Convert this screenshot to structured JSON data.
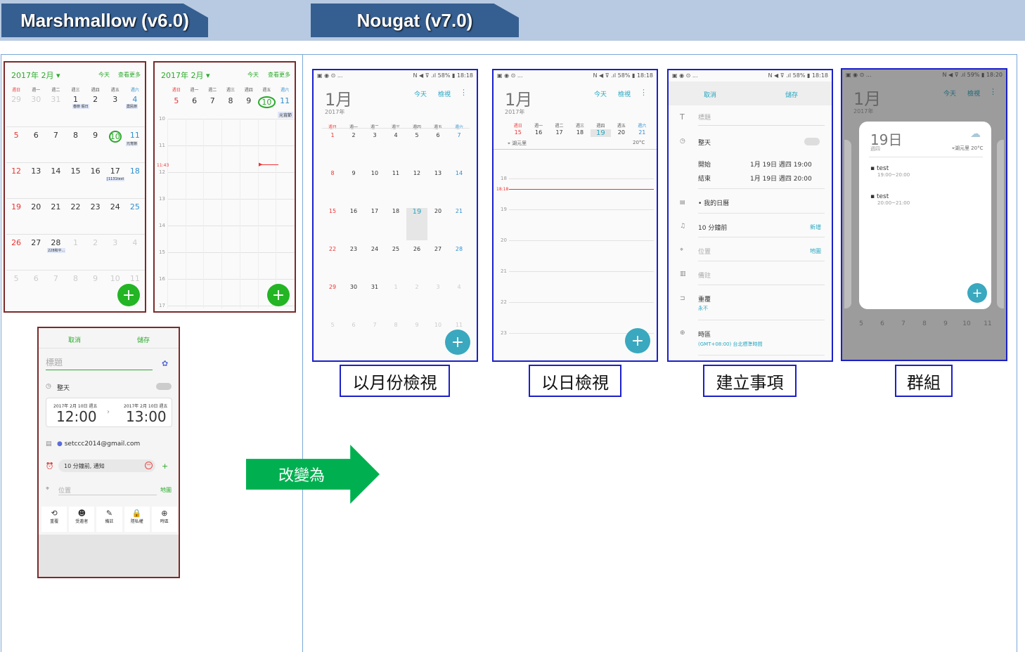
{
  "header": {
    "tab_left": "Marshmallow (v6.0)",
    "tab_right": "Nougat (v7.0)"
  },
  "arrow_label": "改變為",
  "captions": [
    "以月份檢視",
    "以日檢視",
    "建立事項",
    "群組"
  ],
  "m_month": {
    "title": "2017年 2月",
    "today": "今天",
    "more": "查看更多",
    "weekdays": [
      "週日",
      "週一",
      "週二",
      "週三",
      "週四",
      "週五",
      "週六"
    ],
    "weeks": [
      [
        "29",
        "30",
        "31",
        "1",
        "2",
        "3",
        "4"
      ],
      [
        "5",
        "6",
        "7",
        "8",
        "9",
        "10",
        "11"
      ],
      [
        "12",
        "13",
        "14",
        "15",
        "16",
        "17",
        "18"
      ],
      [
        "19",
        "20",
        "21",
        "22",
        "23",
        "24",
        "25"
      ],
      [
        "26",
        "27",
        "28",
        "1",
        "2",
        "3",
        "4"
      ],
      [
        "5",
        "6",
        "7",
        "8",
        "9",
        "10",
        "11"
      ]
    ],
    "events": [
      "春節 假日",
      "農民節",
      "元宵節",
      "[1131test",
      "228和平..."
    ],
    "fab": "+"
  },
  "m_day": {
    "title": "2017年 2月",
    "today": "今天",
    "more": "查看更多",
    "weekdays": [
      "週日",
      "週一",
      "週二",
      "週三",
      "週四",
      "週五",
      "週六"
    ],
    "days": [
      "5",
      "6",
      "7",
      "8",
      "9",
      "10",
      "11"
    ],
    "event": "元宵節",
    "hours": [
      "10",
      "11",
      "12",
      "13",
      "14",
      "15",
      "16",
      "17"
    ],
    "now": "11:43",
    "fab": "+"
  },
  "m_create": {
    "cancel": "取消",
    "save": "儲存",
    "title_placeholder": "標題",
    "allday": "整天",
    "start_date": "2017年 2月 10日 週五",
    "start_time": "12:00",
    "end_date": "2017年 2月 10日 週五",
    "end_time": "13:00",
    "account": "setccc2014@gmail.com",
    "reminder": "10 分鐘前, 通知",
    "location": "位置",
    "map": "地圖",
    "tools": [
      "重覆",
      "受邀者",
      "備註",
      "隱私權",
      "時區"
    ]
  },
  "n_month": {
    "status_left": "▣ ◉ ⊙ ...",
    "status_right": "N ◀ ⊽ .ıl 58% ▮ 18:18",
    "title": "1月",
    "year": "2017年",
    "today": "今天",
    "view": "檢視",
    "weekdays": [
      "週日",
      "週一",
      "週二",
      "週三",
      "週四",
      "週五",
      "週六"
    ],
    "weeks": [
      [
        "1",
        "2",
        "3",
        "4",
        "5",
        "6",
        "7"
      ],
      [
        "8",
        "9",
        "10",
        "11",
        "12",
        "13",
        "14"
      ],
      [
        "15",
        "16",
        "17",
        "18",
        "19",
        "20",
        "21"
      ],
      [
        "22",
        "23",
        "24",
        "25",
        "26",
        "27",
        "28"
      ],
      [
        "29",
        "30",
        "31",
        "1",
        "2",
        "3",
        "4"
      ],
      [
        "5",
        "6",
        "7",
        "8",
        "9",
        "10",
        "11"
      ]
    ],
    "fab": "+"
  },
  "n_day": {
    "status_left": "▣ ◉ ⊙ ...",
    "status_right": "N ◀ ⊽ .ıl 58% ▮ 18:18",
    "title": "1月",
    "year": "2017年",
    "today": "今天",
    "view": "檢視",
    "weekdays": [
      "週日",
      "週一",
      "週二",
      "週三",
      "週四",
      "週五",
      "週六"
    ],
    "days": [
      "15",
      "16",
      "17",
      "18",
      "19",
      "20",
      "21"
    ],
    "location": "湖元里",
    "temp": "20°C",
    "hours": [
      "18",
      "19",
      "20",
      "21",
      "22",
      "23"
    ],
    "now": "18:18",
    "fab": "+"
  },
  "n_create": {
    "status_left": "▣ ◉ ⊙ ...",
    "status_right": "N ◀ ⊽ .ıl 58% ▮ 18:18",
    "cancel": "取消",
    "save": "儲存",
    "title_placeholder": "標題",
    "allday": "整天",
    "start_label": "開始",
    "start_value": "1月 19日 週四 19:00",
    "end_label": "結束",
    "end_value": "1月 19日 週四 20:00",
    "calendar": "• 我的日曆",
    "reminder": "10 分鐘前",
    "add": "新增",
    "location": "位置",
    "map": "地圖",
    "note": "備註",
    "repeat": "重覆",
    "repeat_value": "永不",
    "timezone": "時區",
    "timezone_value": "(GMT+08:00) 台北標準時間"
  },
  "n_group": {
    "status_left": "▣ ◉ ⊙ ...",
    "status_right": "N ◀ ⊽ .ıl 59% ▮ 18:20",
    "title": "1月",
    "year": "2017年",
    "today": "今天",
    "view": "檢視",
    "day_title": "19日",
    "day_sub": "週四",
    "place": "湖元里  20°C",
    "events": [
      {
        "name": "test",
        "time": "19:00~20:00"
      },
      {
        "name": "test",
        "time": "20:00~21:00"
      }
    ],
    "fab": "+"
  }
}
